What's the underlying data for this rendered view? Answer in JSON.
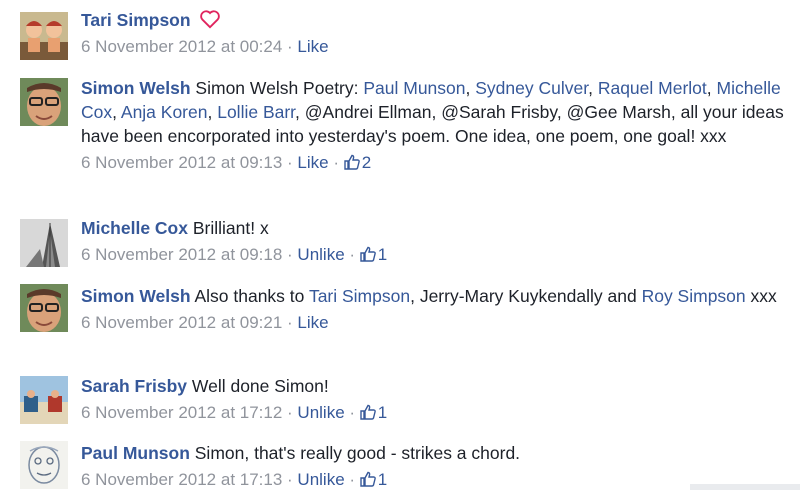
{
  "comments": [
    {
      "author": "Tari Simpson",
      "text_parts": [],
      "timestamp": "6 November 2012 at 00:24",
      "action": "Like",
      "like_count": "",
      "reaction": "heart-icon"
    },
    {
      "author": "Simon Welsh",
      "text": {
        "intro": " Simon Welsh Poetry: ",
        "m1": "Paul Munson",
        "c1": ", ",
        "m2": "Sydney Culver",
        "c2": ", ",
        "m3": "Raquel Merlot",
        "c3": ", ",
        "m4": "Michelle Cox",
        "c4": ", ",
        "m5": "Anja Koren",
        "c5": ", ",
        "m6": "Lollie Barr",
        "rest": ", @Andrei Ellman, @Sarah Frisby, @Gee Marsh, all your ideas have been encorporated into yesterday's poem. One idea, one poem, one goal! xxx"
      },
      "timestamp": "6 November 2012 at 09:13",
      "action": "Like",
      "like_count": "2"
    },
    {
      "author": "Michelle Cox",
      "text": {
        "body": " Brilliant! x"
      },
      "timestamp": "6 November 2012 at 09:18",
      "action": "Unlike",
      "like_count": "1"
    },
    {
      "author": "Simon Welsh",
      "text": {
        "intro": " Also thanks to ",
        "m1": "Tari Simpson",
        "mid": ", Jerry-Mary Kuykendally and ",
        "m2": "Roy Simpson",
        "end": " xxx"
      },
      "timestamp": "6 November 2012 at 09:21",
      "action": "Like",
      "like_count": ""
    },
    {
      "author": "Sarah Frisby",
      "text": {
        "body": " Well done Simon!"
      },
      "timestamp": "6 November 2012 at 17:12",
      "action": "Unlike",
      "like_count": "1"
    },
    {
      "author": "Paul Munson",
      "text": {
        "body": " Simon, that's really good - strikes a chord."
      },
      "timestamp": "6 November 2012 at 17:13",
      "action": "Unlike",
      "like_count": "1"
    }
  ],
  "separator": " · ",
  "colors": {
    "link": "#365899",
    "meta": "#90949c",
    "text": "#1d2129",
    "heart": "#e0245e"
  }
}
